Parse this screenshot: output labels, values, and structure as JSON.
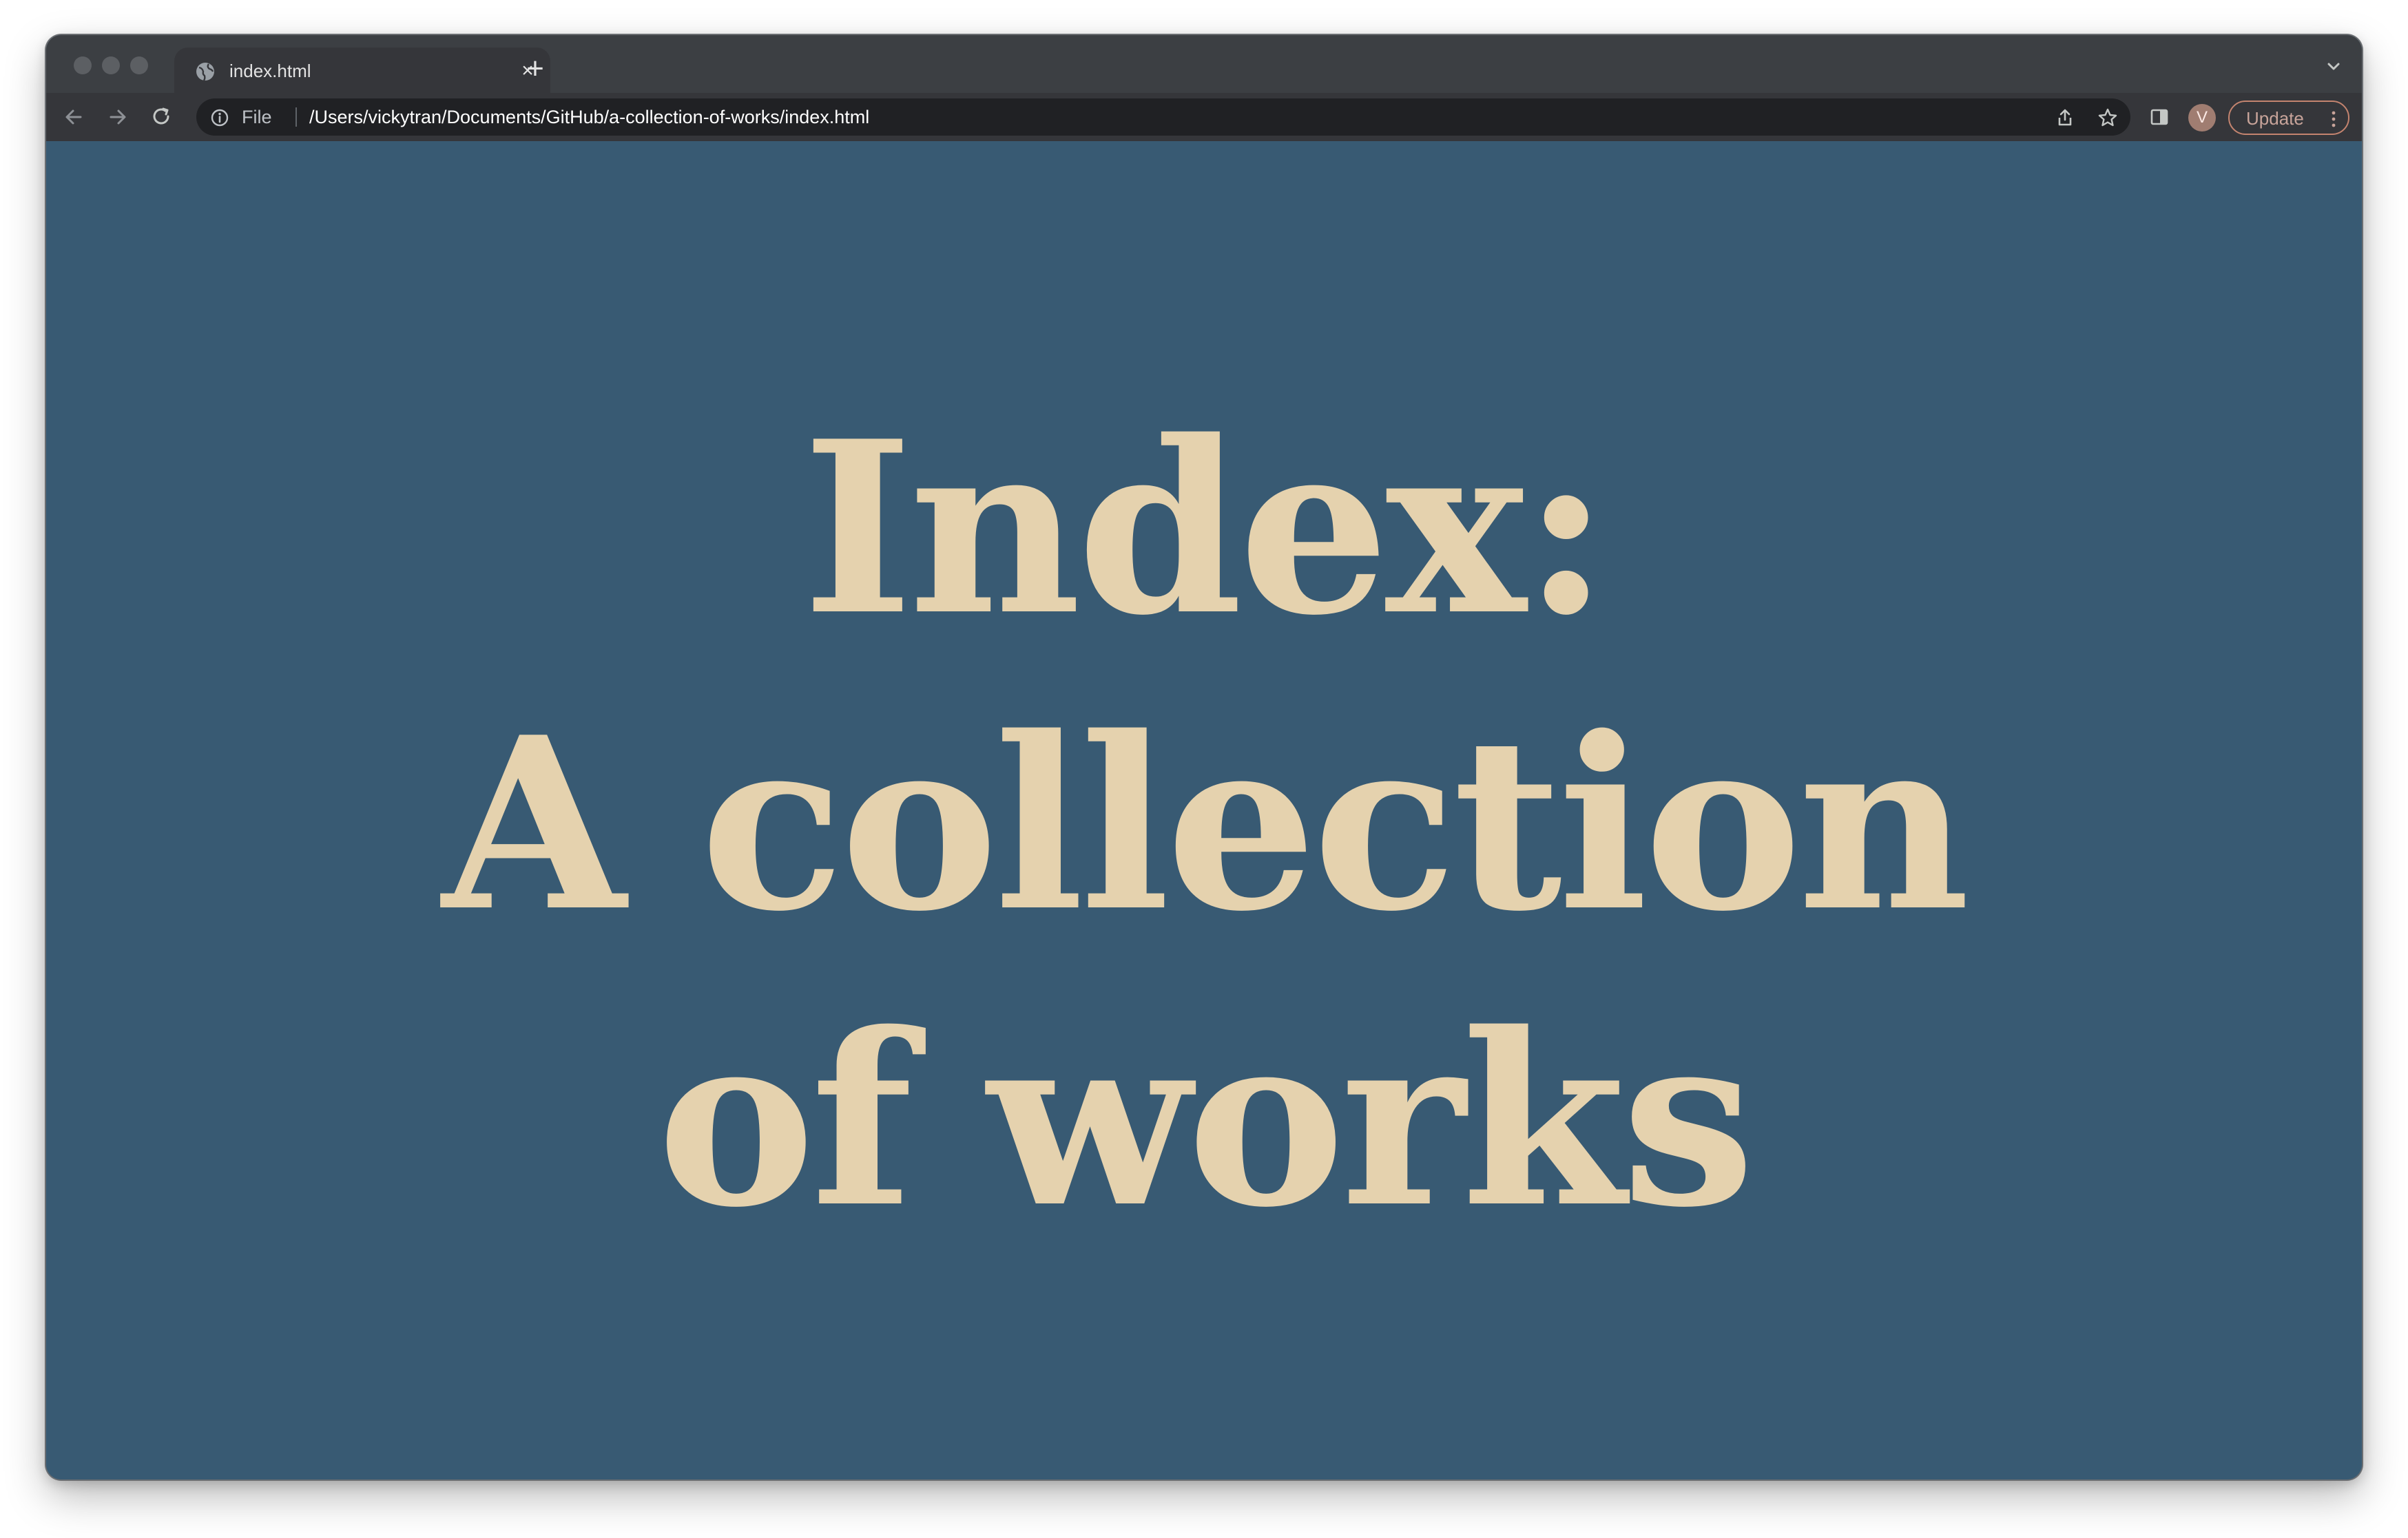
{
  "browser": {
    "tab": {
      "title": "index.html",
      "close_glyph": "×",
      "favicon": "globe-icon"
    },
    "new_tab_glyph": "+",
    "omnibox": {
      "scheme_label": "File",
      "url": "/Users/vickytran/Documents/GitHub/a-collection-of-works/index.html"
    },
    "profile_initial": "V",
    "update_label": "Update"
  },
  "page": {
    "background": "#385a73",
    "text_color": "#e5d2ae",
    "heading_lines": [
      "Index:",
      "A collection",
      "of works"
    ]
  }
}
